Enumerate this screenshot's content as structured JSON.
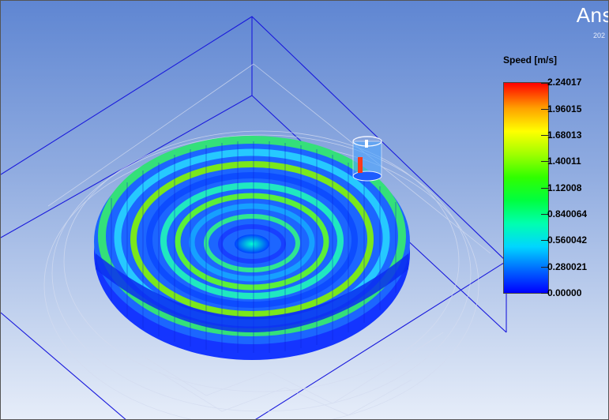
{
  "branding": {
    "name": "Ans",
    "subtitle": "202"
  },
  "legend": {
    "title": "Speed [m/s]",
    "ticks": [
      "2.24017",
      "1.96015",
      "1.68013",
      "1.40011",
      "1.12008",
      "0.840064",
      "0.560042",
      "0.280021",
      "0.00000"
    ],
    "colors": [
      "#0000ff",
      "#00d6ff",
      "#00ff40",
      "#ffff00",
      "#ff0000"
    ]
  },
  "colors": {
    "background_top": "#5f86d2",
    "background_bottom": "#e6edf9",
    "bounding_box": "#1a1adc"
  }
}
